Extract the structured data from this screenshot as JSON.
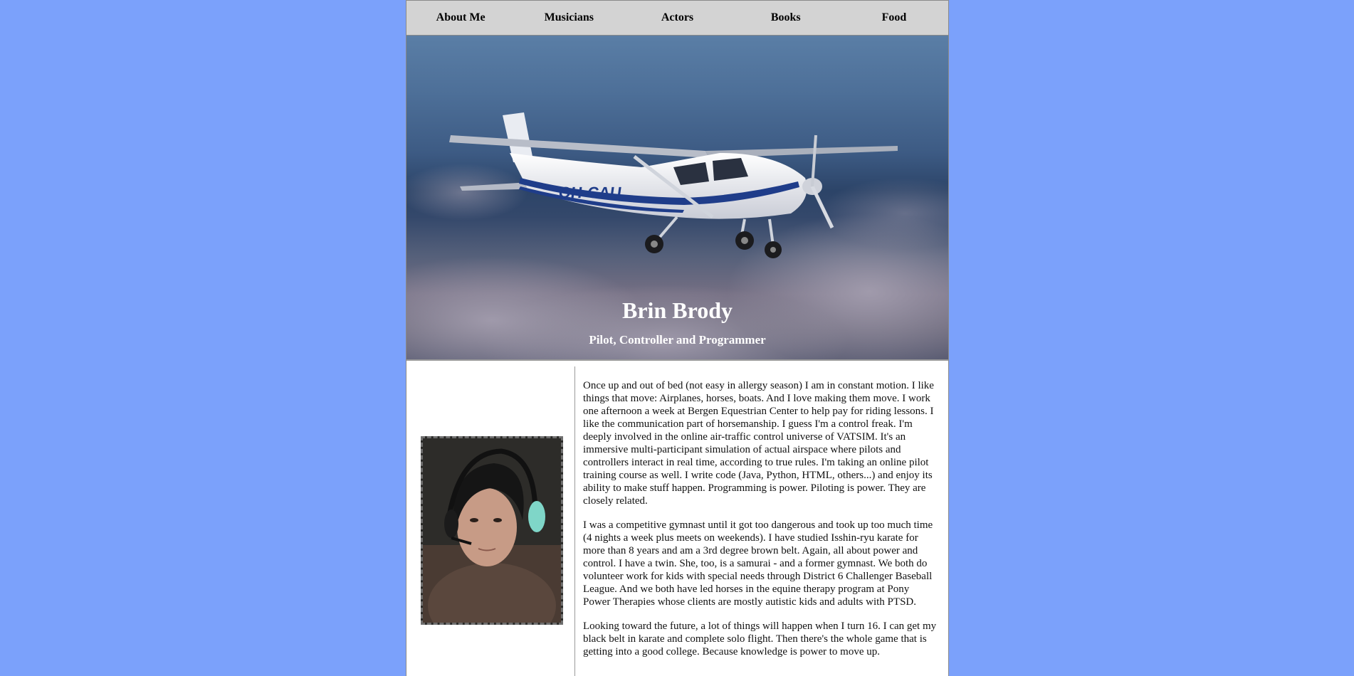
{
  "nav": {
    "items": [
      {
        "label": "About Me"
      },
      {
        "label": "Musicians"
      },
      {
        "label": "Actors"
      },
      {
        "label": "Books"
      },
      {
        "label": "Food"
      }
    ]
  },
  "hero": {
    "title": "Brin Brody",
    "subtitle": "Pilot, Controller and Programmer",
    "aircraft_registration": "OH-CAU"
  },
  "content": {
    "paragraphs": [
      "Once up and out of bed (not easy in allergy season) I am in constant motion. I like things that move: Airplanes, horses, boats. And I love making them move. I work one afternoon a week at Bergen Equestrian Center to help pay for riding lessons. I like the communication part of horsemanship. I guess I'm a control freak. I'm deeply involved in the online air-traffic control universe of VATSIM. It's an immersive multi-participant simulation of actual airspace where pilots and controllers interact in real time, according to true rules. I'm taking an online pilot training course as well. I write code (Java, Python, HTML, others...) and enjoy its ability to make stuff happen. Programming is power. Piloting is power. They are closely related.",
      "I was a competitive gymnast until it got too dangerous and took up too much time (4 nights a week plus meets on weekends). I have studied Isshin-ryu karate for more than 8 years and am a 3rd degree brown belt. Again, all about power and control. I have a twin. She, too, is a samurai - and a former gymnast. We both do volunteer work for kids with special needs through District 6 Challenger Baseball League. And we both have led horses in the equine therapy program at Pony Power Therapies whose clients are mostly autistic kids and adults with PTSD.",
      "Looking toward the future, a lot of things will happen when I turn 16. I can get my black belt in karate and complete solo flight. Then there's the whole game that is getting into a good college. Because knowledge is power to move up."
    ]
  }
}
